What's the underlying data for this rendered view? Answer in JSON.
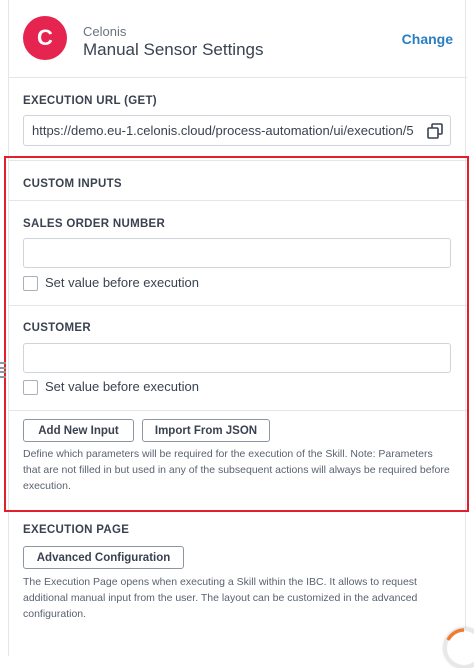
{
  "header": {
    "vendor": "Celonis",
    "title": "Manual Sensor Settings",
    "change_label": "Change",
    "logo_letter": "C",
    "logo_color": "#e52450"
  },
  "execution_url": {
    "label": "EXECUTION URL (GET)",
    "value": "https://demo.eu-1.celonis.cloud/process-automation/ui/execution/5",
    "copy_icon": "copy-icon"
  },
  "custom_inputs": {
    "label": "CUSTOM INPUTS",
    "inputs": [
      {
        "label": "SALES ORDER NUMBER",
        "value": "",
        "checkbox_label": "Set value before execution",
        "checked": false
      },
      {
        "label": "CUSTOMER",
        "value": "",
        "checkbox_label": "Set value before execution",
        "checked": false
      }
    ],
    "add_button": "Add New Input",
    "import_button": "Import From JSON",
    "help_text": "Define which parameters will be required for the execution of the Skill. Note: Parameters that are not filled in but used in any of the subsequent actions will always be required before execution."
  },
  "execution_page": {
    "label": "EXECUTION PAGE",
    "button": "Advanced Configuration",
    "help_text": "The Execution Page opens when executing a Skill within the IBC. It allows to request additional manual input from the user. The layout can be customized in the advanced configuration."
  },
  "colors": {
    "accent": "#2a7ec2",
    "highlight_frame": "#e0202a"
  }
}
